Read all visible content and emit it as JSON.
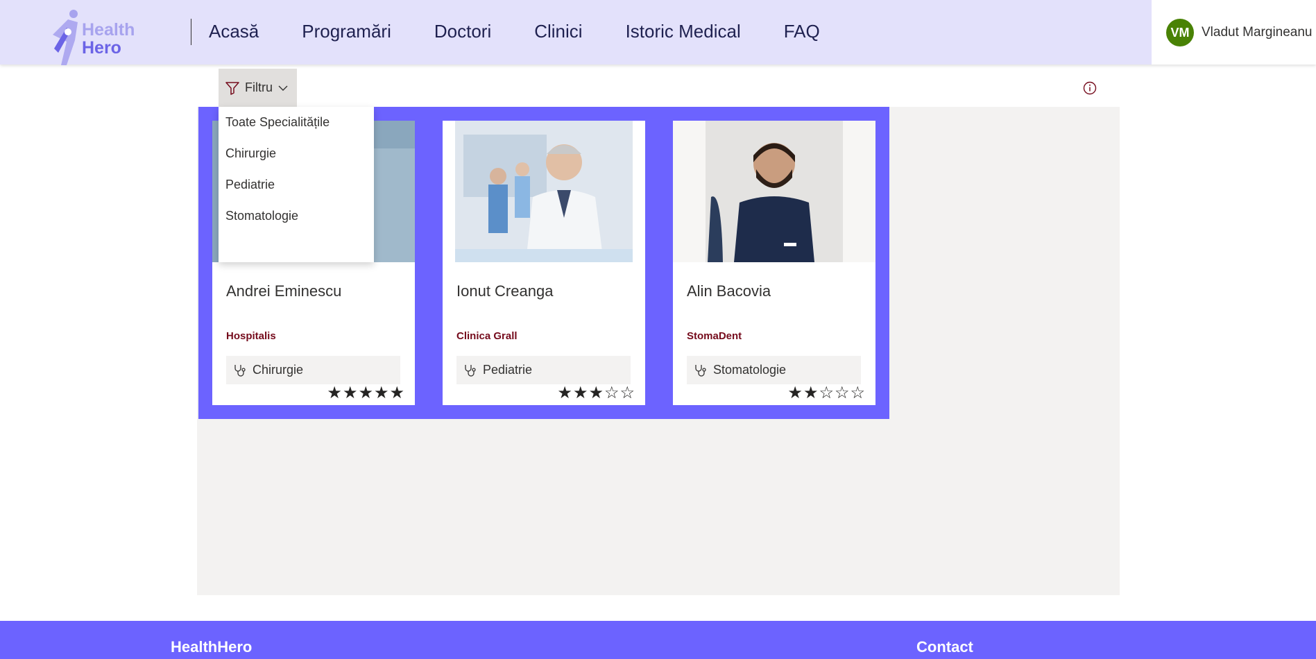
{
  "header": {
    "logo": {
      "line1": "Health",
      "line2": "Hero"
    },
    "nav": [
      "Acasă",
      "Programări",
      "Doctori",
      "Clinici",
      "Istoric Medical",
      "FAQ"
    ],
    "user": {
      "initials": "VM",
      "name": "Vladut Margineanu",
      "avatar_color": "#498205"
    }
  },
  "toolbar": {
    "filter_label": "Filtru",
    "filter_options": [
      "Toate Specialitățile",
      "Chirurgie",
      "Pediatrie",
      "Stomatologie"
    ]
  },
  "doctors": [
    {
      "name": "Andrei Eminescu",
      "clinic": "Hospitalis",
      "specialty": "Chirurgie",
      "rating": 4.5,
      "stars_text": "★★★★★"
    },
    {
      "name": "Ionut Creanga",
      "clinic": "Clinica Grall",
      "specialty": "Pediatrie",
      "rating": 2.5,
      "stars_text": "★★★☆☆"
    },
    {
      "name": "Alin Bacovia",
      "clinic": "StomaDent",
      "specialty": "Stomatologie",
      "rating": 2,
      "stars_text": "★★☆☆☆"
    }
  ],
  "footer": {
    "brand": "HealthHero",
    "contact": "Contact"
  },
  "colors": {
    "accent": "#6c63ff",
    "header_bg": "#e3e1fb",
    "clinic_text": "#750b1c"
  }
}
